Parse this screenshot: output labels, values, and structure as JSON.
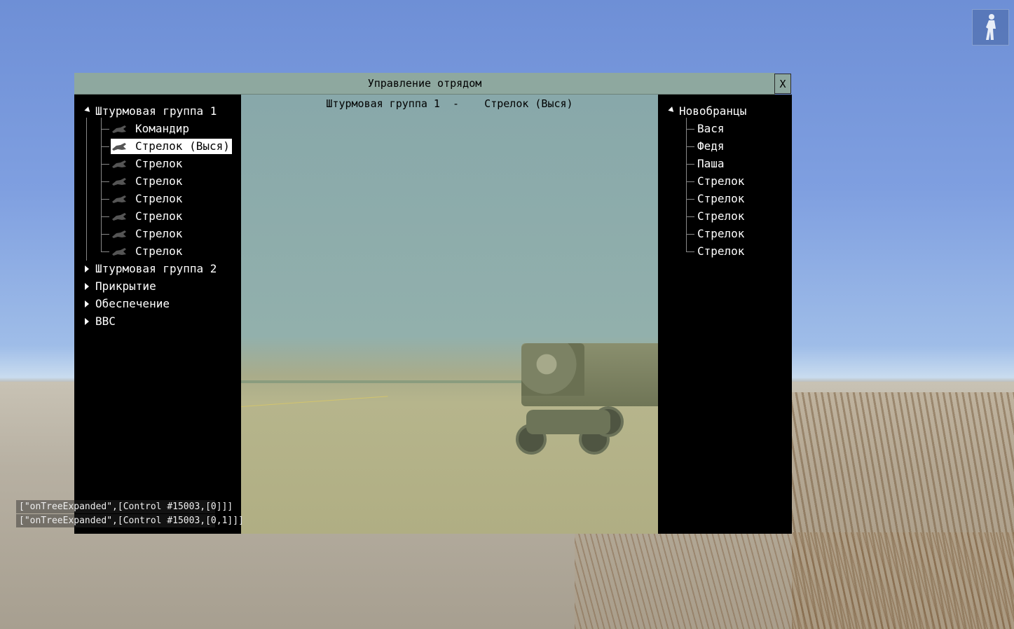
{
  "dialog": {
    "title": "Управление отрядом",
    "close_label": "X"
  },
  "viewport": {
    "title": "Штурмовая группа 1  -    Стрелок (Выся)"
  },
  "left_tree": {
    "groups": [
      {
        "label": "Штурмовая группа 1",
        "expanded": true,
        "members": [
          {
            "label": "Командир",
            "selected": false
          },
          {
            "label": "Стрелок (Выся)",
            "selected": true
          },
          {
            "label": "Стрелок",
            "selected": false
          },
          {
            "label": "Стрелок",
            "selected": false
          },
          {
            "label": "Стрелок",
            "selected": false
          },
          {
            "label": "Стрелок",
            "selected": false
          },
          {
            "label": "Стрелок",
            "selected": false
          },
          {
            "label": "Стрелок",
            "selected": false
          }
        ]
      },
      {
        "label": "Штурмовая группа 2",
        "expanded": false
      },
      {
        "label": "Прикрытие",
        "expanded": false
      },
      {
        "label": "Обеспечение",
        "expanded": false
      },
      {
        "label": "ВВС",
        "expanded": false
      }
    ]
  },
  "right_tree": {
    "root": {
      "label": "Новобранцы",
      "expanded": true
    },
    "members": [
      "Вася",
      "Федя",
      "Паша",
      "Стрелок",
      "Стрелок",
      "Стрелок",
      "Стрелок",
      "Стрелок"
    ]
  },
  "debug_log": [
    "[\"onTreeExpanded\",[Control #15003,[0]]]",
    "[\"onTreeExpanded\",[Control #15003,[0,1]]]"
  ],
  "icons": {
    "player": "soldier-standing-icon",
    "unit": "soldier-prone-icon"
  }
}
